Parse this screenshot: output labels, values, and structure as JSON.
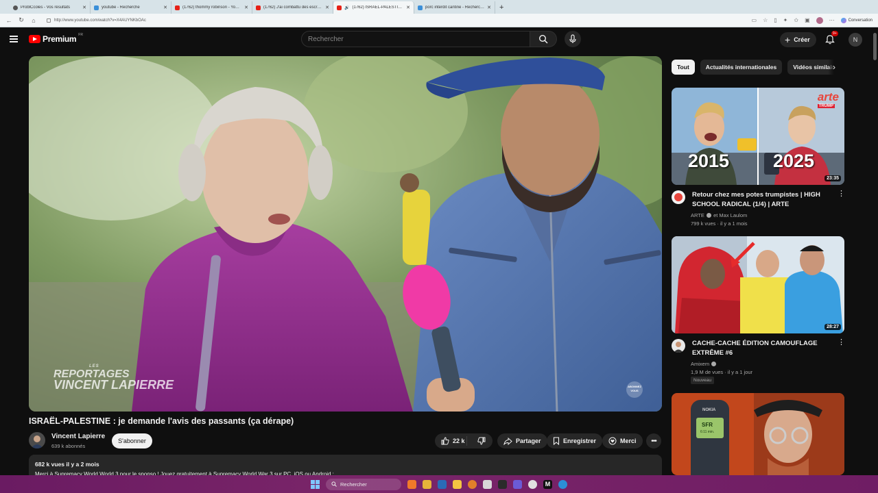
{
  "browser": {
    "tabs": [
      {
        "title": "ProblCcoles - Vos résultats",
        "favicon": "dd"
      },
      {
        "title": "youtube - Recherche",
        "favicon": "bing"
      },
      {
        "title": "(1762) thommy robinson - YouTu...",
        "favicon": "yt"
      },
      {
        "title": "(1762) J'ai combattu des escroc...",
        "favicon": "yt"
      },
      {
        "title": "(1762) ISRAËL-PALESTINE : je...",
        "favicon": "yt",
        "active": true
      },
      {
        "title": "porc interdit cantine - Recherche",
        "favicon": "bing"
      }
    ],
    "url": "http://www.youtube.com/watch?v=X4AUYNKbOAc",
    "copilot_label": "Conversation"
  },
  "header": {
    "brand": "Premium",
    "country": "FR",
    "search_placeholder": "Rechercher",
    "create_label": "Créer",
    "notif_count": "9+",
    "user_initial": "N"
  },
  "video": {
    "watermark_small": "LES",
    "watermark_line1": "REPORTAGES",
    "watermark_line2": "VINCENT LAPIERRE",
    "watermark_right": "ABONNEZ VOUS",
    "title": "ISRAËL-PALESTINE : je demande l'avis des passants (ça dérape)",
    "channel": "Vincent Lapierre",
    "subscribers": "639 k abonnés",
    "subscribe_label": "S'abonner",
    "likes": "22 k",
    "share_label": "Partager",
    "save_label": "Enregistrer",
    "thanks_label": "Merci",
    "views_date": "682 k vues  il y a 2 mois",
    "description": "Merci à Supremacy World World 3 pour le sponso ! Jouez gratuitement à Supremacy World War 3 sur PC, iOS ou Android :"
  },
  "chips": [
    "Tout",
    "Actualités internationales",
    "Vidéos similaires"
  ],
  "recommendations": [
    {
      "title": "Retour chez mes potes trumpistes | HIGH SCHOOL RADICAL (1/4) | ARTE",
      "channel": "ARTE",
      "channel_extra": "et Max Laulom",
      "stats": "799 k vues · il y a 1 mois",
      "duration": "23:35",
      "thumb_left": "2015",
      "thumb_right": "2025",
      "thumb_brand": "arte",
      "thumb_tag": "TRUMP"
    },
    {
      "title": "CACHE-CACHE ÉDITION CAMOUFLAGE EXTRÊME #6",
      "channel": "Amixem",
      "stats": "1,9 M de vues · il y a 1 jour",
      "badge": "Nouveau",
      "duration": "28:27"
    },
    {
      "thumb_phone_brand": "NOKIA",
      "thumb_phone_screen": "SFR",
      "thumb_phone_time": "6:11 min."
    }
  ],
  "taskbar": {
    "search_placeholder": "Rechercher"
  }
}
